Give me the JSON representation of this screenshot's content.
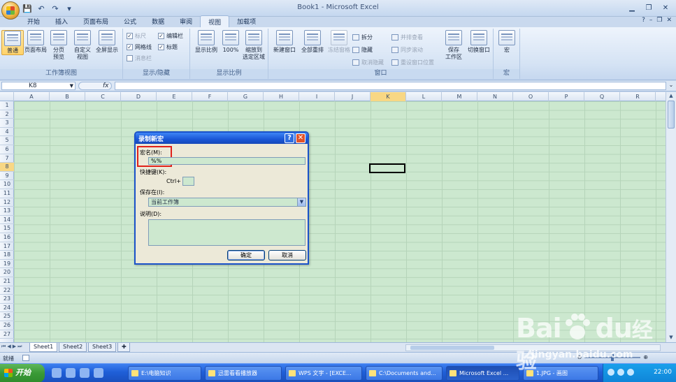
{
  "window": {
    "title": "Book1 - Microsoft Excel"
  },
  "qat": {
    "icons": [
      "save-icon",
      "undo-icon",
      "redo-icon",
      "customize-icon"
    ]
  },
  "tabs": [
    {
      "label": "开始"
    },
    {
      "label": "插入"
    },
    {
      "label": "页面布局"
    },
    {
      "label": "公式"
    },
    {
      "label": "数据"
    },
    {
      "label": "审阅"
    },
    {
      "label": "视图",
      "active": true
    },
    {
      "label": "加载项"
    }
  ],
  "ribbon": {
    "groups": {
      "workbook_views": {
        "label": "工作簿视图",
        "normal": "普通",
        "page_layout": "页面布局",
        "page_break_1": "分页",
        "page_break_2": "预览",
        "custom_1": "自定义",
        "custom_2": "视图",
        "full_screen": "全屏显示"
      },
      "show_hide": {
        "label": "显示/隐藏",
        "ruler": "标尺",
        "gridlines": "网格线",
        "message_bar": "消息栏",
        "formula_bar": "编辑栏",
        "headings": "标题"
      },
      "zoom": {
        "label": "显示比例",
        "zoom": "显示比例",
        "zoom100": "100%",
        "zoom_sel_1": "缩放到",
        "zoom_sel_2": "选定区域"
      },
      "window": {
        "label": "窗口",
        "new_window": "新建窗口",
        "arrange_all": "全部重排",
        "freeze_panes": "冻结窗格",
        "split": "拆分",
        "hide": "隐藏",
        "unhide": "取消隐藏",
        "side_by_side": "并排查看",
        "sync_scroll": "同步滚动",
        "reset_pos": "重设窗口位置",
        "save_ws_1": "保存",
        "save_ws_2": "工作区",
        "switch_win": "切换窗口"
      },
      "macros": {
        "label": "宏",
        "macros": "宏"
      }
    }
  },
  "formula_bar": {
    "name_box": "K8",
    "fx": "fx",
    "value": ""
  },
  "grid": {
    "columns": [
      "A",
      "B",
      "C",
      "D",
      "E",
      "F",
      "G",
      "H",
      "I",
      "J",
      "K",
      "L",
      "M",
      "N",
      "O",
      "P",
      "Q",
      "R"
    ],
    "rows": [
      "1",
      "2",
      "3",
      "4",
      "5",
      "6",
      "7",
      "8",
      "9",
      "10",
      "11",
      "12",
      "13",
      "14",
      "15",
      "16",
      "17",
      "18",
      "19",
      "20",
      "21",
      "22",
      "23",
      "24",
      "25",
      "26",
      "27"
    ],
    "selected_col": "K",
    "selected_row": "8",
    "gridline_color": "#b5d4b9",
    "cell_bg": "#cce8cf"
  },
  "sheets": {
    "tabs": [
      {
        "label": "Sheet1",
        "active": true
      },
      {
        "label": "Sheet2"
      },
      {
        "label": "Sheet3"
      }
    ]
  },
  "status_bar": {
    "text": "就绪"
  },
  "dialog": {
    "title": "录制新宏",
    "macro_name_label": "宏名(M):",
    "macro_name_value": "%%",
    "shortcut_label": "快捷键(K):",
    "shortcut_prefix": "Ctrl+",
    "shortcut_value": "",
    "store_in_label": "保存在(I):",
    "store_in_value": "当前工作簿",
    "description_label": "说明(D):",
    "description_value": "",
    "ok_label": "确定",
    "cancel_label": "取消"
  },
  "taskbar": {
    "start_label": "开始",
    "items": [
      {
        "label": "E:\\电脑知识"
      },
      {
        "label": "迅雷看看播放器"
      },
      {
        "label": "WPS 文字 - [EXCE..."
      },
      {
        "label": "C:\\Documents and..."
      },
      {
        "label": "Microsoft Excel ...",
        "active": true
      },
      {
        "label": "1.JPG - 画图"
      }
    ],
    "clock": "22:00"
  },
  "watermark": {
    "logo_text": "Bai",
    "logo_text2": "du",
    "logo_suffix": "经验",
    "url": "jingyan.baidu.com"
  }
}
